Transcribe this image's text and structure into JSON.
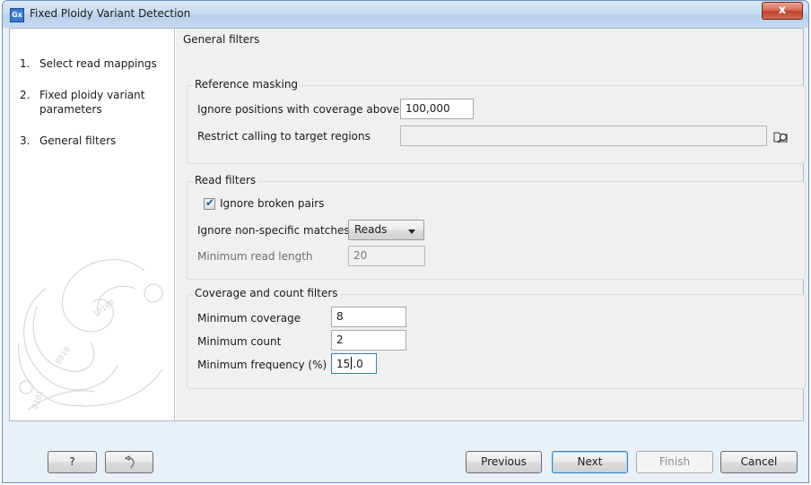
{
  "window": {
    "title": "Fixed Ploidy Variant Detection",
    "app_icon_text": "Gx",
    "close_symbol": "x"
  },
  "sidebar": {
    "steps": [
      {
        "num": "1.",
        "label": "Select read mappings"
      },
      {
        "num": "2.",
        "label": "Fixed ploidy variant parameters"
      },
      {
        "num": "3.",
        "label": "General filters"
      }
    ]
  },
  "main": {
    "title": "General filters",
    "reference_masking": {
      "title": "Reference masking",
      "coverage_label": "Ignore positions with coverage above",
      "coverage_value": "100,000",
      "target_label": "Restrict calling to target regions",
      "target_value": ""
    },
    "read_filters": {
      "title": "Read filters",
      "broken_pairs_label": "Ignore broken pairs",
      "broken_pairs_checked": true,
      "nonspecific_label": "Ignore non-specific matches",
      "nonspecific_value": "Reads",
      "min_length_label": "Minimum read length",
      "min_length_value": "20"
    },
    "coverage_filters": {
      "title": "Coverage and count filters",
      "min_coverage_label": "Minimum coverage",
      "min_coverage_value": "8",
      "min_count_label": "Minimum count",
      "min_count_value": "2",
      "min_freq_label": "Minimum frequency (%)",
      "min_freq_before_caret": "15",
      "min_freq_after_caret": ".0"
    }
  },
  "footer": {
    "help_label": "?",
    "previous_label": "Previous",
    "next_label": "Next",
    "finish_label": "Finish",
    "cancel_label": "Cancel"
  }
}
